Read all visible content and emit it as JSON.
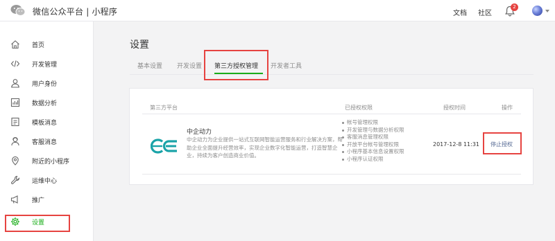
{
  "header": {
    "brand": "微信公众平台 | 小程序",
    "links": {
      "docs": "文档",
      "community": "社区"
    },
    "notification_count": "2"
  },
  "sidebar": {
    "items": [
      {
        "label": "首页",
        "icon": "home-icon"
      },
      {
        "label": "开发管理",
        "icon": "code-icon"
      },
      {
        "label": "用户身份",
        "icon": "user-icon"
      },
      {
        "label": "数据分析",
        "icon": "chart-icon"
      },
      {
        "label": "模板消息",
        "icon": "document-icon"
      },
      {
        "label": "客服消息",
        "icon": "customer-service-icon"
      },
      {
        "label": "附近的小程序",
        "icon": "location-icon"
      },
      {
        "label": "运维中心",
        "icon": "wrench-icon"
      },
      {
        "label": "推广",
        "icon": "megaphone-icon"
      },
      {
        "label": "设置",
        "icon": "gear-icon",
        "active": true
      }
    ]
  },
  "main": {
    "title": "设置",
    "tabs": [
      {
        "label": "基本设置"
      },
      {
        "label": "开发设置"
      },
      {
        "label": "第三方授权管理",
        "active": true
      },
      {
        "label": "开发者工具"
      }
    ],
    "table": {
      "headers": {
        "platform": "第三方平台",
        "permissions": "已授权权限",
        "time": "授权时间",
        "action": "操作"
      },
      "row": {
        "name": "中企动力",
        "description": "中企动力为企业提供一站式互联网智能运营服务和行业解决方案，帮助企业全面提升经营效率，实现企业数字化智能运营，打造智慧企业，持续为客户创造商业价值。",
        "permissions": [
          "帐号管理权限",
          "开发管理与数据分析权限",
          "客服消息管理权限",
          "开放平台帐号管理权限",
          "小程序基本信息设置权限",
          "小程序认证权限"
        ],
        "time": "2017-12-8 11:31",
        "action": "停止授权"
      }
    }
  },
  "colors": {
    "accent": "#1aad19",
    "highlight": "#e64340",
    "link": "#576b95"
  }
}
